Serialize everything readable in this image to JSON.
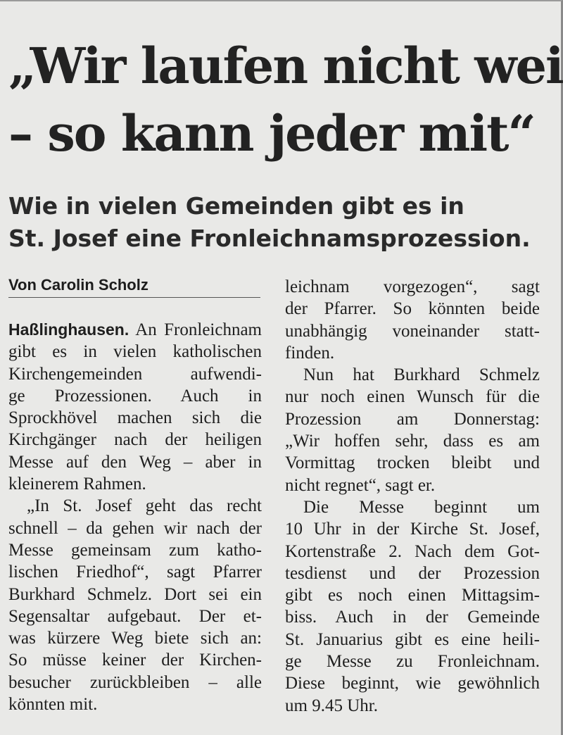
{
  "article": {
    "headline_lines": [
      "„Wir laufen nicht weit",
      "– so kann jeder mit“"
    ],
    "subheadline_lines": [
      "Wie in vielen Gemeinden gibt es in",
      "St. Josef eine Fronleichnamsprozession."
    ],
    "byline": "Von Carolin Scholz",
    "dateline": "Haßlinghausen.",
    "left_column": [
      "An Fronleichnam",
      "gibt es in vielen katholischen",
      "Kirchengemeinden aufwendi-",
      "ge Prozessionen. Auch in",
      "Sprockhövel machen sich die",
      "Kirchgänger nach der heiligen",
      "Messe auf den Weg – aber in",
      "kleinerem Rahmen.",
      "„In St. Josef geht das recht",
      "schnell – da gehen wir nach der",
      "Messe gemeinsam zum katho-",
      "lischen Friedhof“, sagt Pfarrer",
      "Burkhard Schmelz. Dort sei ein",
      "Segensaltar aufgebaut. Der et-",
      "was kürzere Weg biete sich an:",
      "So müsse keiner der Kirchen-",
      "besucher zurückbleiben – alle",
      "könnten mit."
    ],
    "right_column": [
      "leichnam vorgezogen“, sagt",
      "der Pfarrer. So könnten beide",
      "unabhängig voneinander statt-",
      "finden.",
      "Nun hat Burkhard Schmelz",
      "nur noch einen Wunsch für die",
      "Prozession am Donnerstag:",
      "„Wir hoffen sehr, dass es am",
      "Vormittag trocken bleibt und",
      "nicht regnet“, sagt er.",
      "Die Messe beginnt um",
      "10 Uhr in der Kirche St. Josef,",
      "Kortenstraße 2. Nach dem Got-",
      "tesdienst und der Prozession",
      "gibt es noch einen Mittagsim-",
      "biss. Auch in der Gemeinde",
      "St. Januarius gibt es eine heili-",
      "ge Messe zu Fronleichnam.",
      "Diese beginnt, wie gewöhnlich",
      "um 9.45 Uhr."
    ]
  }
}
